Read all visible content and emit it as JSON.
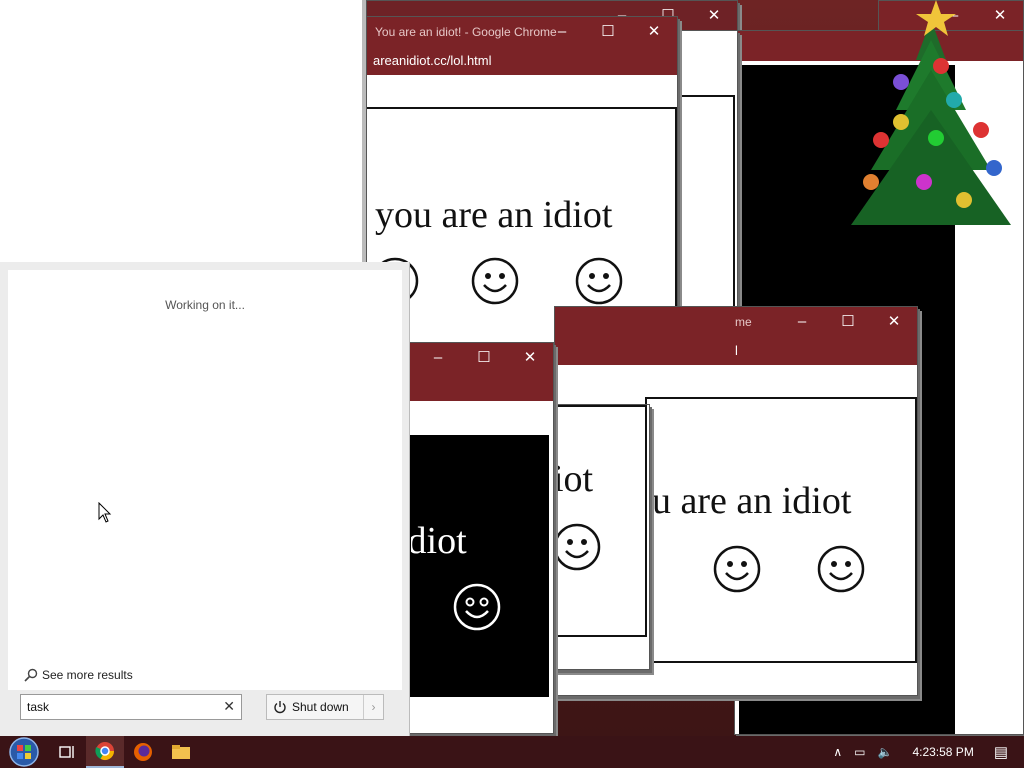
{
  "window": {
    "title": "You are an idiot! - Google Chrome",
    "url": "areanidiot.cc/lol.html",
    "url_short": "l",
    "title_short": "me",
    "controls": {
      "minimize": "–",
      "maximize": "☐",
      "close": "✕"
    }
  },
  "content": {
    "message": "you are an idiot",
    "message_partial_a": "you are an idiot",
    "message_partial_b": "ou are an idiot",
    "message_partial_c": "idiot",
    "message_partial_d": "iot",
    "message_partial_e": "t"
  },
  "start_menu": {
    "status": "Working on it...",
    "see_more": "See more results",
    "search_value": "task",
    "clear_icon": "✕",
    "shutdown_label": "Shut down",
    "shutdown_arrow": "›"
  },
  "taskbar": {
    "clock": "4:23:58 PM"
  },
  "colors": {
    "titlebar": "#7b2327",
    "taskbar": "#3a1316"
  }
}
